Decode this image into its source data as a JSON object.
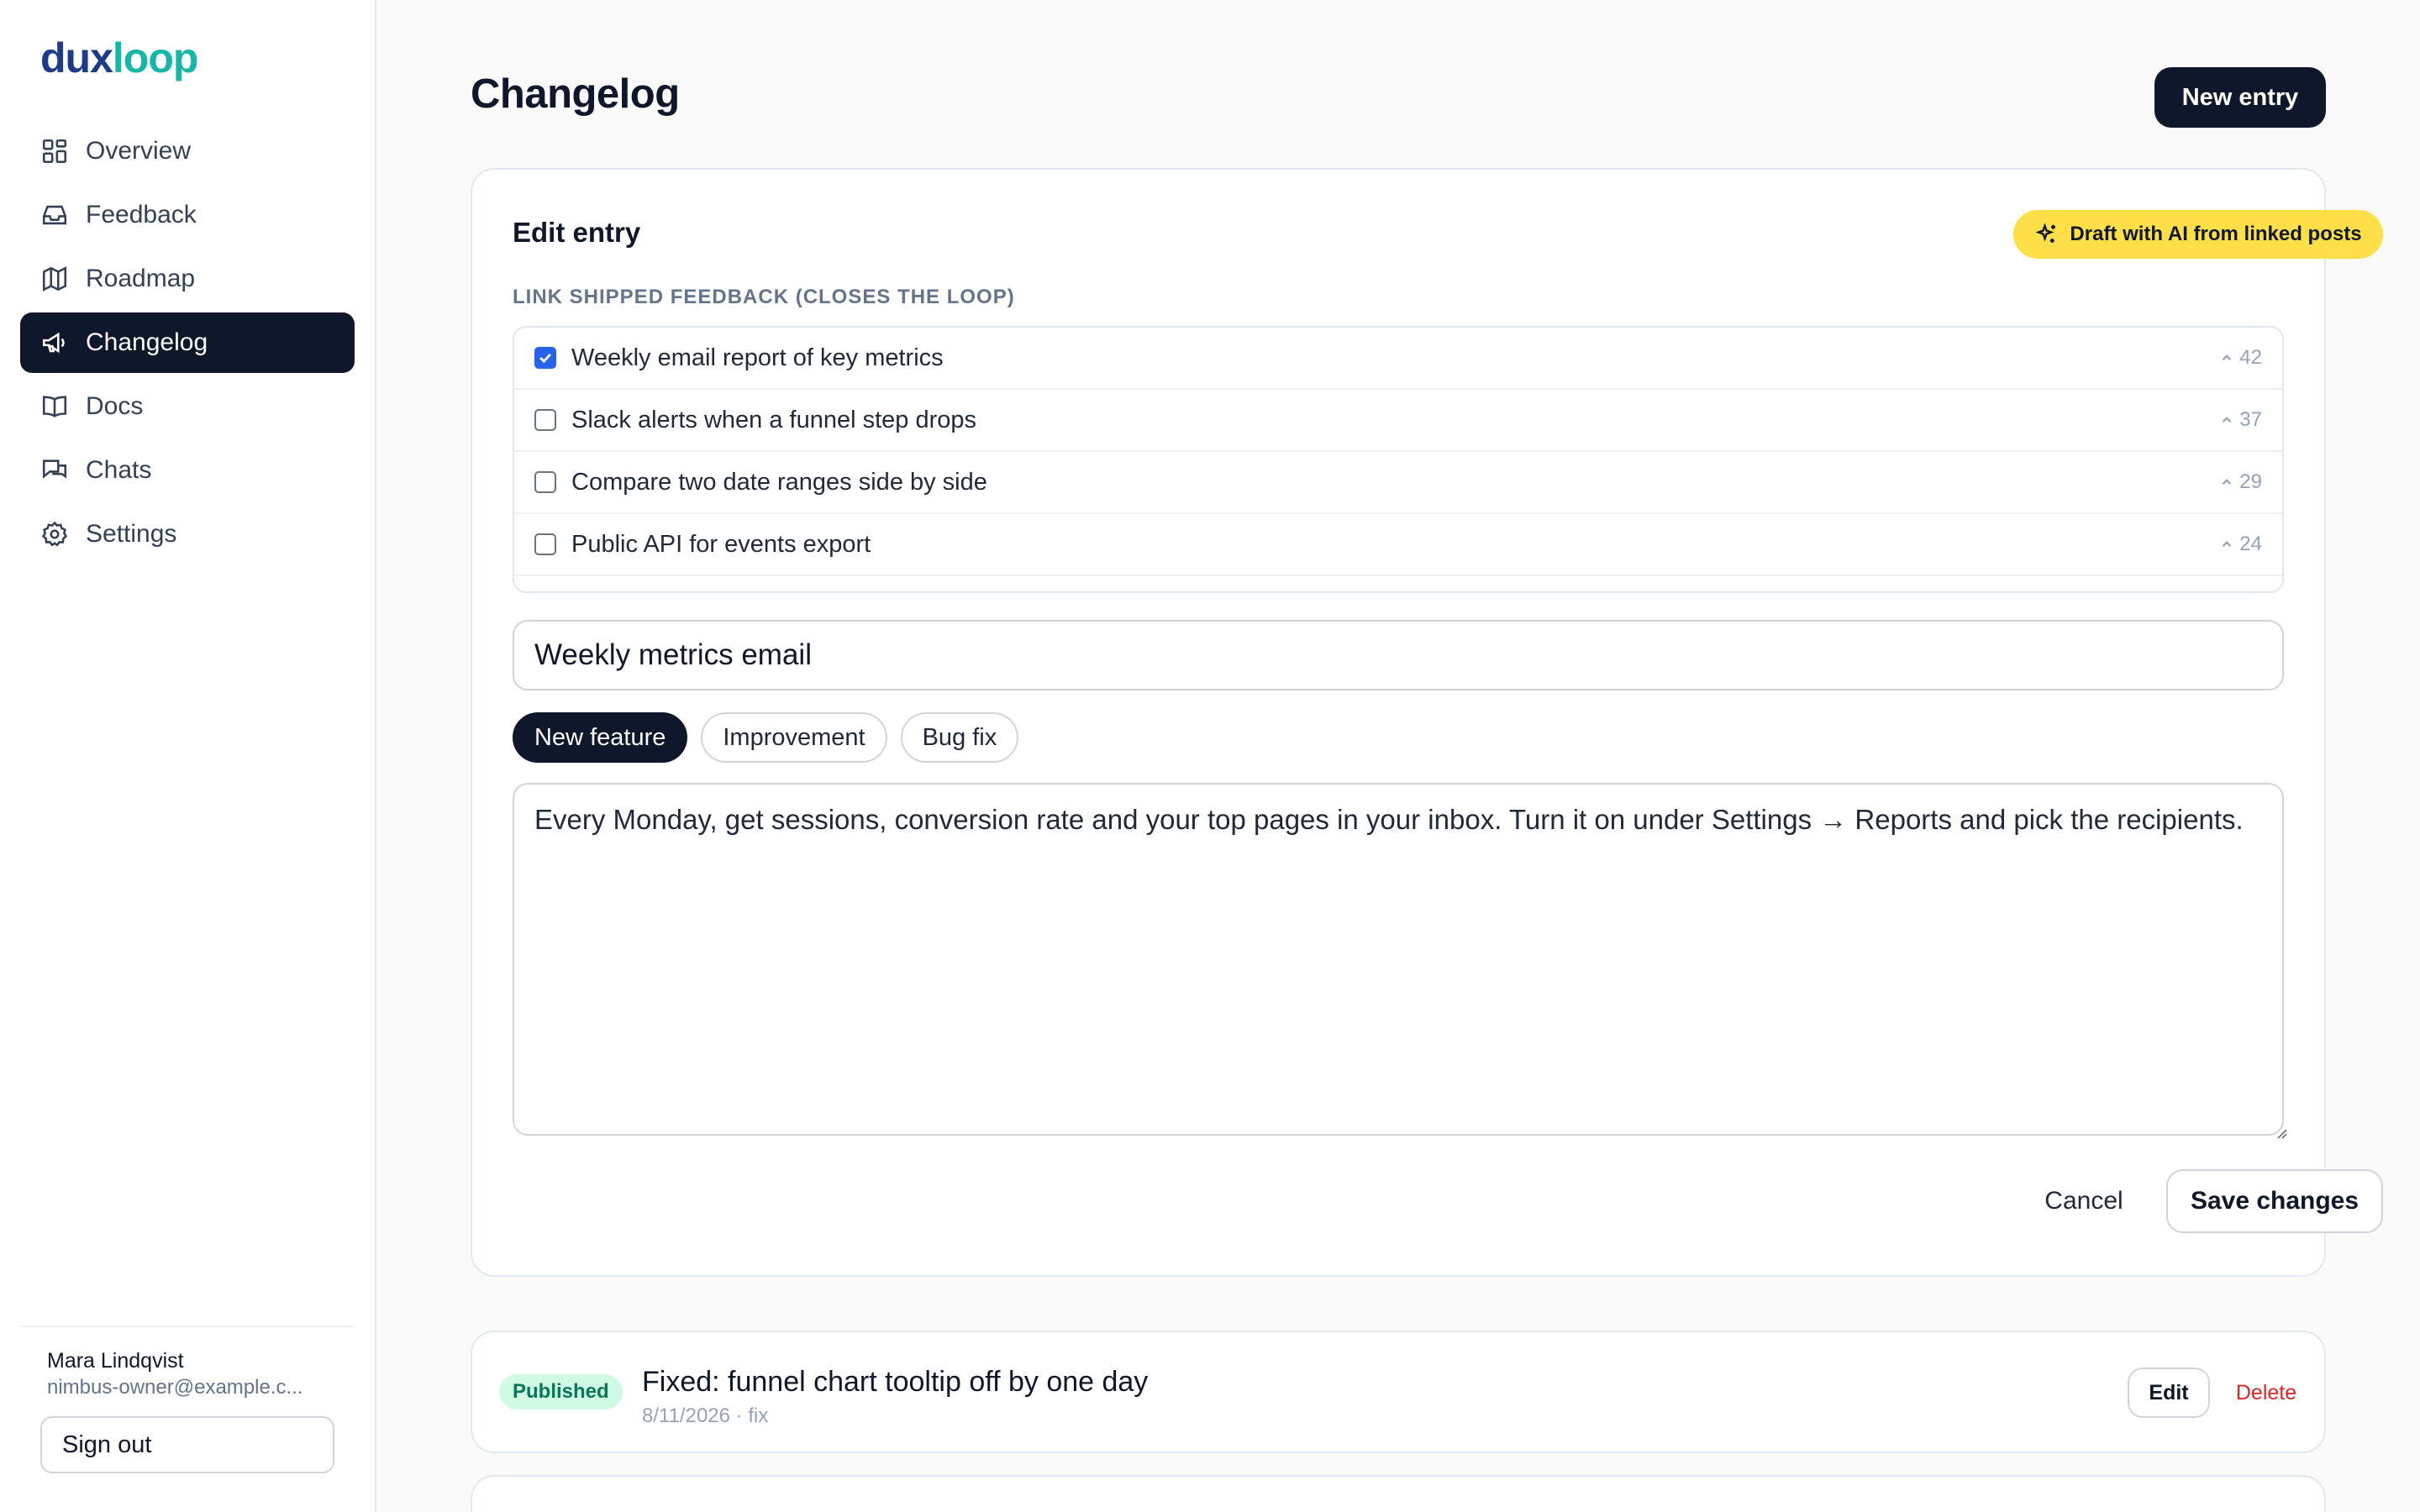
{
  "app": {
    "logo_part1": "dux",
    "logo_part2": "loop"
  },
  "sidebar": {
    "items": [
      {
        "label": "Overview",
        "icon": "grid-icon"
      },
      {
        "label": "Feedback",
        "icon": "inbox-icon"
      },
      {
        "label": "Roadmap",
        "icon": "map-icon"
      },
      {
        "label": "Changelog",
        "icon": "megaphone-icon",
        "active": true
      },
      {
        "label": "Docs",
        "icon": "book-icon"
      },
      {
        "label": "Chats",
        "icon": "chat-icon"
      },
      {
        "label": "Settings",
        "icon": "gear-icon"
      }
    ],
    "user_name": "Mara Lindqvist",
    "user_email": "nimbus-owner@example.c...",
    "sign_out_label": "Sign out"
  },
  "header": {
    "title": "Changelog",
    "new_entry_label": "New entry"
  },
  "editor": {
    "title": "Edit entry",
    "ai_button_label": "Draft with AI from linked posts",
    "section_label": "LINK SHIPPED FEEDBACK (CLOSES THE LOOP)",
    "linked_posts": [
      {
        "label": "Weekly email report of key metrics",
        "votes": "42",
        "checked": true
      },
      {
        "label": "Slack alerts when a funnel step drops",
        "votes": "37",
        "checked": false
      },
      {
        "label": "Compare two date ranges side by side",
        "votes": "29",
        "checked": false
      },
      {
        "label": "Public API for events export",
        "votes": "24",
        "checked": false
      }
    ],
    "title_value": "Weekly metrics email",
    "types": [
      {
        "label": "New feature",
        "active": true
      },
      {
        "label": "Improvement",
        "active": false
      },
      {
        "label": "Bug fix",
        "active": false
      }
    ],
    "body_value": "Every Monday, get sessions, conversion rate and your top pages in your inbox. Turn it on under Settings → Reports and pick the recipients.",
    "cancel_label": "Cancel",
    "save_label": "Save changes"
  },
  "entries": [
    {
      "status": "Published",
      "title": "Fixed: funnel chart tooltip off by one day",
      "meta": "8/11/2026 · fix",
      "edit_label": "Edit",
      "delete_label": "Delete"
    }
  ],
  "colors": {
    "primary_dark": "#0f172a",
    "ai_yellow": "#fde047",
    "published_bg": "#d1fae5",
    "published_text": "#047857",
    "delete_red": "#dc2626",
    "checkbox_blue": "#2563eb",
    "logo_navy": "#1e3a8a",
    "logo_teal": "#14b8a6"
  }
}
